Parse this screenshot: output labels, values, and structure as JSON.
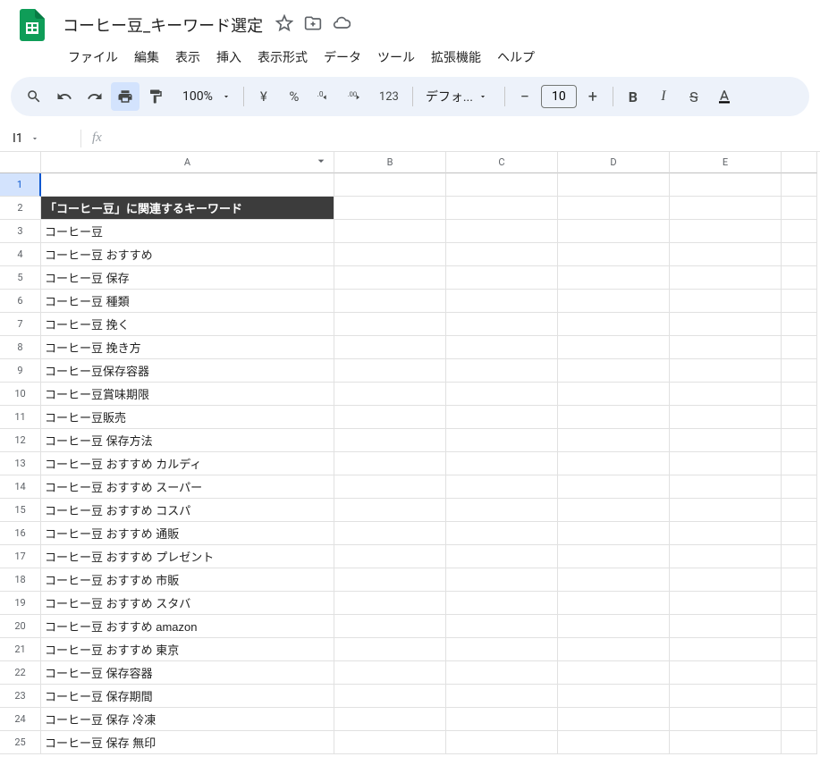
{
  "doc_title": "コーヒー豆_キーワード選定",
  "menus": [
    "ファイル",
    "編集",
    "表示",
    "挿入",
    "表示形式",
    "データ",
    "ツール",
    "拡張機能",
    "ヘルプ"
  ],
  "toolbar": {
    "zoom": "100%",
    "font_name": "デフォ...",
    "font_size": "10",
    "fmt123": "123"
  },
  "cell_ref": "I1",
  "fx_label": "fx",
  "columns": [
    "A",
    "B",
    "C",
    "D",
    "E"
  ],
  "rows": [
    {
      "n": "1",
      "a": ""
    },
    {
      "n": "2",
      "a": "「コーヒー豆」に関連するキーワード",
      "header": true
    },
    {
      "n": "3",
      "a": "コーヒー豆"
    },
    {
      "n": "4",
      "a": "コーヒー豆 おすすめ"
    },
    {
      "n": "5",
      "a": "コーヒー豆 保存"
    },
    {
      "n": "6",
      "a": "コーヒー豆 種類"
    },
    {
      "n": "7",
      "a": "コーヒー豆 挽く"
    },
    {
      "n": "8",
      "a": "コーヒー豆 挽き方"
    },
    {
      "n": "9",
      "a": "コーヒー豆保存容器"
    },
    {
      "n": "10",
      "a": "コーヒー豆賞味期限"
    },
    {
      "n": "11",
      "a": "コーヒー豆販売"
    },
    {
      "n": "12",
      "a": "コーヒー豆 保存方法"
    },
    {
      "n": "13",
      "a": "コーヒー豆 おすすめ カルディ"
    },
    {
      "n": "14",
      "a": "コーヒー豆 おすすめ スーパー"
    },
    {
      "n": "15",
      "a": "コーヒー豆 おすすめ コスパ"
    },
    {
      "n": "16",
      "a": "コーヒー豆 おすすめ 通販"
    },
    {
      "n": "17",
      "a": "コーヒー豆 おすすめ プレゼント"
    },
    {
      "n": "18",
      "a": "コーヒー豆 おすすめ 市販"
    },
    {
      "n": "19",
      "a": "コーヒー豆 おすすめ スタバ"
    },
    {
      "n": "20",
      "a": "コーヒー豆 おすすめ amazon"
    },
    {
      "n": "21",
      "a": "コーヒー豆 おすすめ 東京"
    },
    {
      "n": "22",
      "a": "コーヒー豆 保存容器"
    },
    {
      "n": "23",
      "a": "コーヒー豆 保存期間"
    },
    {
      "n": "24",
      "a": "コーヒー豆 保存 冷凍"
    },
    {
      "n": "25",
      "a": "コーヒー豆 保存 無印"
    }
  ]
}
